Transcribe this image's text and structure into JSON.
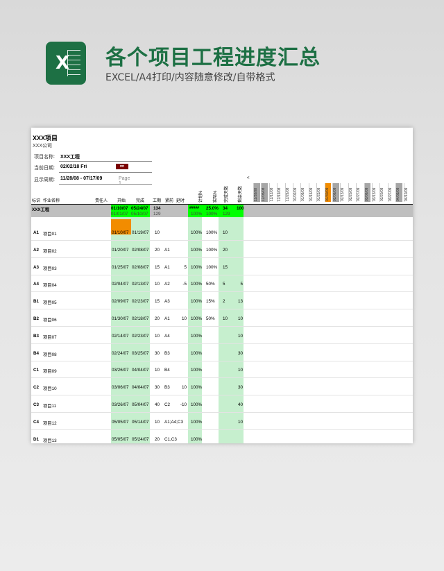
{
  "header": {
    "title": "各个项目工程进度汇总",
    "subtitle": "EXCEL/A4打印/内容随意修改/自带格式",
    "logo_letter": "X"
  },
  "sheet": {
    "project_title": "XXX项目",
    "company": "XXX公司",
    "info": [
      {
        "label": "项目名称:",
        "value": "XXX工程"
      },
      {
        "label": "当前日期:",
        "value": "02/02/18 Fri",
        "badge": "◘◘"
      },
      {
        "label": "显示周期:",
        "value": "11/28/08 - 07/17/09",
        "page": "Page 1"
      }
    ],
    "scroll_arrow": "<",
    "columns": {
      "id": "标识",
      "name": "作业名称",
      "owner": "责任人",
      "start": "开始",
      "finish": "完成",
      "duration": "工期",
      "predecessor": "紧前",
      "slack": "延时",
      "planned": "计划%",
      "actual": "实际%",
      "done_days": "完成天数",
      "remaining_days": "剩余天数"
    },
    "dates": [
      "11/28/08",
      "12/05/08",
      "12/12/08",
      "12/19/08",
      "12/26/08",
      "01/02/09",
      "01/09/09",
      "01/16/09",
      "01/23/09",
      "01/30/09",
      "02/06/09",
      "02/13/09",
      "02/20/09",
      "02/27/09",
      "03/06/09",
      "03/13/09",
      "03/20/09",
      "03/27/09",
      "04/03/09",
      "04/10/09"
    ],
    "summary": {
      "name": "XXX工程",
      "start": "01/10/07",
      "finish": "05/24/07",
      "duration": "134",
      "planned": "#####",
      "actual": "25.0%",
      "done_days": "34",
      "remaining_days": "100",
      "start2": "01/01/07",
      "finish2": "05/10/07",
      "duration2": "129",
      "planned2": "100%",
      "actual2": "100%",
      "done_days2": "129"
    },
    "rows": [
      {
        "id": "A1",
        "name": "项目01",
        "start": "01/10/07",
        "finish": "01/19/07",
        "duration": "10",
        "pred": "",
        "slack": "",
        "planned": "100%",
        "actual": "100%",
        "done": "10",
        "remain": ""
      },
      {
        "id": "A2",
        "name": "项目02",
        "start": "01/20/07",
        "finish": "02/08/07",
        "duration": "20",
        "pred": "A1",
        "slack": "",
        "planned": "100%",
        "actual": "100%",
        "done": "20",
        "remain": ""
      },
      {
        "id": "A3",
        "name": "项目03",
        "start": "01/25/07",
        "finish": "02/08/07",
        "duration": "15",
        "pred": "A1",
        "slack": "5",
        "planned": "100%",
        "actual": "100%",
        "done": "15",
        "remain": ""
      },
      {
        "id": "A4",
        "name": "项目04",
        "start": "02/04/07",
        "finish": "02/13/07",
        "duration": "10",
        "pred": "A2",
        "slack": "-5",
        "planned": "100%",
        "actual": "50%",
        "done": "5",
        "remain": "5"
      },
      {
        "id": "B1",
        "name": "项目05",
        "start": "02/09/07",
        "finish": "02/23/07",
        "duration": "15",
        "pred": "A3",
        "slack": "",
        "planned": "100%",
        "actual": "15%",
        "done": "2",
        "remain": "13"
      },
      {
        "id": "B2",
        "name": "项目06",
        "start": "01/30/07",
        "finish": "02/18/07",
        "duration": "20",
        "pred": "A1",
        "slack": "10",
        "planned": "100%",
        "actual": "50%",
        "done": "10",
        "remain": "10"
      },
      {
        "id": "B3",
        "name": "项目07",
        "start": "02/14/07",
        "finish": "02/23/07",
        "duration": "10",
        "pred": "A4",
        "slack": "",
        "planned": "100%",
        "actual": "",
        "done": "",
        "remain": "10"
      },
      {
        "id": "B4",
        "name": "项目08",
        "start": "02/24/07",
        "finish": "03/25/07",
        "duration": "30",
        "pred": "B3",
        "slack": "",
        "planned": "100%",
        "actual": "",
        "done": "",
        "remain": "30"
      },
      {
        "id": "C1",
        "name": "项目09",
        "start": "03/26/07",
        "finish": "04/04/07",
        "duration": "10",
        "pred": "B4",
        "slack": "",
        "planned": "100%",
        "actual": "",
        "done": "",
        "remain": "10"
      },
      {
        "id": "C2",
        "name": "项目10",
        "start": "03/06/07",
        "finish": "04/04/07",
        "duration": "30",
        "pred": "B3",
        "slack": "10",
        "planned": "100%",
        "actual": "",
        "done": "",
        "remain": "30"
      },
      {
        "id": "C3",
        "name": "项目11",
        "start": "03/26/07",
        "finish": "05/04/07",
        "duration": "40",
        "pred": "C2",
        "slack": "-10",
        "planned": "100%",
        "actual": "",
        "done": "",
        "remain": "40"
      },
      {
        "id": "C4",
        "name": "项目12",
        "start": "05/05/07",
        "finish": "05/14/07",
        "duration": "10",
        "pred": "A1;A4;C3",
        "slack": "",
        "planned": "100%",
        "actual": "",
        "done": "",
        "remain": "10"
      },
      {
        "id": "D1",
        "name": "项目13",
        "start": "05/05/07",
        "finish": "05/24/07",
        "duration": "20",
        "pred": "C1,C3",
        "slack": "",
        "planned": "100%",
        "actual": "",
        "done": "",
        "remain": ""
      }
    ]
  },
  "colors": {
    "brand": "#1d7044",
    "green": "#00ff00",
    "light_green": "#c6efce",
    "orange": "#f28c00",
    "summary_gray": "#bfbfbf"
  }
}
